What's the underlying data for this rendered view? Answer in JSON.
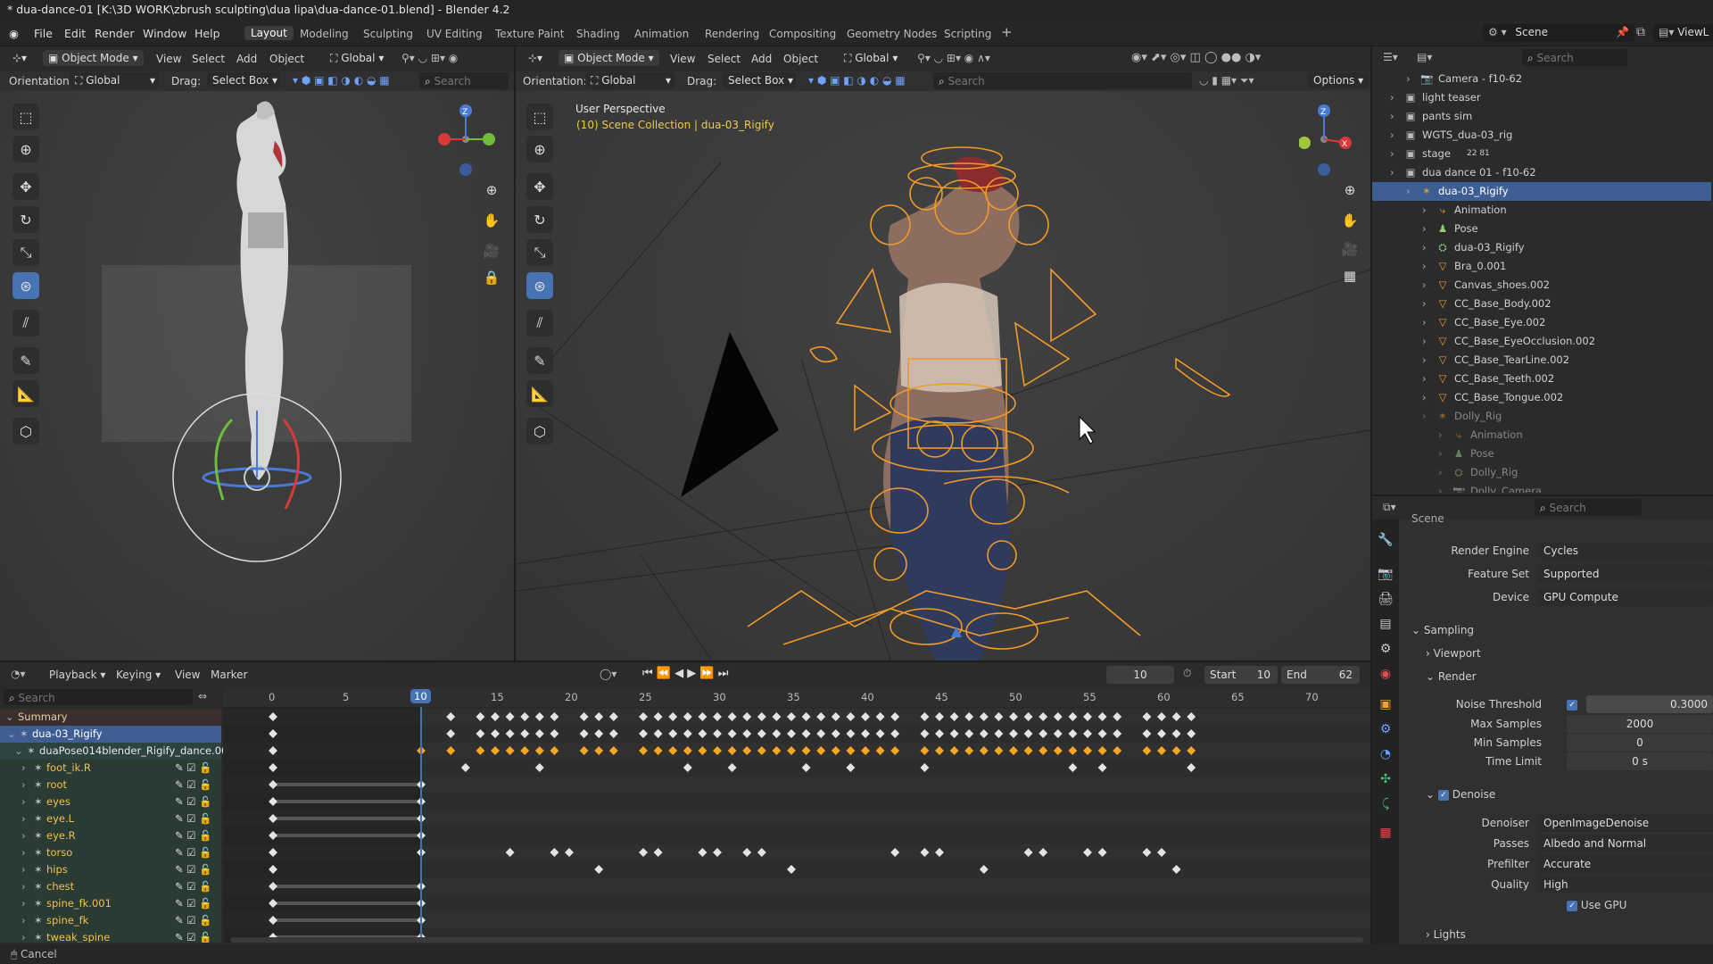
{
  "window": {
    "title": "* dua-dance-01 [K:\\3D WORK\\zbrush sculpting\\dua lipa\\dua-dance-01.blend] - Blender 4.2"
  },
  "menu": [
    "File",
    "Edit",
    "Render",
    "Window",
    "Help"
  ],
  "workspaces": [
    "Layout",
    "Modeling",
    "Sculpting",
    "UV Editing",
    "Texture Paint",
    "Shading",
    "Animation",
    "Rendering",
    "Compositing",
    "Geometry Nodes",
    "Scripting"
  ],
  "active_workspace": "Layout",
  "scene": {
    "name": "Scene",
    "view_layer": "ViewL"
  },
  "vp_left": {
    "mode": "Object Mode",
    "menus": [
      "View",
      "Select",
      "Add",
      "Object"
    ],
    "transform": "Global",
    "orientation_label": "Orientation:",
    "orientation": "Global",
    "drag_label": "Drag:",
    "drag": "Select Box",
    "search_placeholder": "Search"
  },
  "vp_main": {
    "mode": "Object Mode",
    "menus": [
      "View",
      "Select",
      "Add",
      "Object"
    ],
    "transform": "Global",
    "orientation_label": "Orientation:",
    "orientation": "Global",
    "drag_label": "Drag:",
    "drag": "Select Box",
    "search_placeholder": "Search",
    "options": "Options",
    "view_name": "User Perspective",
    "collection": "(10) Scene Collection | dua-03_Rigify",
    "gizmo": {
      "z": "Z",
      "x": "X"
    }
  },
  "outliner": {
    "search_placeholder": "Search",
    "rows": [
      {
        "label": "Camera - f10-62",
        "icon": "camera-icon",
        "depth": 2
      },
      {
        "label": "light teaser",
        "icon": "collection-icon",
        "depth": 1
      },
      {
        "label": "pants sim",
        "icon": "collection-icon",
        "depth": 1
      },
      {
        "label": "WGTS_dua-03_rig",
        "icon": "collection-icon",
        "depth": 1
      },
      {
        "label": "stage",
        "icon": "collection-icon",
        "depth": 1,
        "badge": "22  81"
      },
      {
        "label": "dua dance 01 - f10-62",
        "icon": "collection-icon",
        "depth": 1
      },
      {
        "label": "dua-03_Rigify",
        "icon": "armature-icon",
        "depth": 2,
        "selected": true
      },
      {
        "label": "Animation",
        "icon": "animation-icon",
        "depth": 3
      },
      {
        "label": "Pose",
        "icon": "pose-icon",
        "depth": 3
      },
      {
        "label": "dua-03_Rigify",
        "icon": "armature-data-icon",
        "depth": 3
      },
      {
        "label": "Bra_0.001",
        "icon": "mesh-icon",
        "depth": 3
      },
      {
        "label": "Canvas_shoes.002",
        "icon": "mesh-icon",
        "depth": 3
      },
      {
        "label": "CC_Base_Body.002",
        "icon": "mesh-icon",
        "depth": 3
      },
      {
        "label": "CC_Base_Eye.002",
        "icon": "mesh-icon",
        "depth": 3
      },
      {
        "label": "CC_Base_EyeOcclusion.002",
        "icon": "mesh-icon",
        "depth": 3
      },
      {
        "label": "CC_Base_TearLine.002",
        "icon": "mesh-icon",
        "depth": 3
      },
      {
        "label": "CC_Base_Teeth.002",
        "icon": "mesh-icon",
        "depth": 3
      },
      {
        "label": "CC_Base_Tongue.002",
        "icon": "mesh-icon",
        "depth": 3
      },
      {
        "label": "Dolly_Rig",
        "icon": "armature-icon",
        "depth": 3,
        "dim": true
      },
      {
        "label": "Animation",
        "icon": "animation-icon",
        "depth": 4,
        "dim": true
      },
      {
        "label": "Pose",
        "icon": "pose-icon",
        "depth": 4,
        "dim": true
      },
      {
        "label": "Dolly_Rig",
        "icon": "armature-data-icon",
        "depth": 4,
        "dim": true
      },
      {
        "label": "Dolly_Camera",
        "icon": "camera-icon",
        "depth": 4,
        "dim": true
      }
    ]
  },
  "properties": {
    "search_placeholder": "Search",
    "section": "Scene",
    "render_engine": {
      "label": "Render Engine",
      "value": "Cycles"
    },
    "feature_set": {
      "label": "Feature Set",
      "value": "Supported"
    },
    "device": {
      "label": "Device",
      "value": "GPU Compute"
    },
    "sampling": "Sampling",
    "viewport": "Viewport",
    "render": "Render",
    "noise_threshold": {
      "label": "Noise Threshold",
      "value": "0.3000",
      "checked": true
    },
    "max_samples": {
      "label": "Max Samples",
      "value": "2000"
    },
    "min_samples": {
      "label": "Min Samples",
      "value": "0"
    },
    "time_limit": {
      "label": "Time Limit",
      "value": "0 s"
    },
    "denoise": {
      "label": "Denoise",
      "checked": true
    },
    "denoiser": {
      "label": "Denoiser",
      "value": "OpenImageDenoise"
    },
    "passes": {
      "label": "Passes",
      "value": "Albedo and Normal"
    },
    "prefilter": {
      "label": "Prefilter",
      "value": "Accurate"
    },
    "quality": {
      "label": "Quality",
      "value": "High"
    },
    "use_gpu": {
      "label": "Use GPU",
      "checked": true
    },
    "lights": "Lights"
  },
  "timeline": {
    "menus": [
      "Playback",
      "Keying",
      "View",
      "Marker"
    ],
    "current_frame": "10",
    "start_label": "Start",
    "start": "10",
    "end_label": "End",
    "end": "62",
    "search_placeholder": "Search",
    "ruler": [
      "0",
      "5",
      "10",
      "15",
      "20",
      "25",
      "30",
      "35",
      "40",
      "45",
      "50",
      "55",
      "60",
      "65",
      "70"
    ],
    "playhead": "10",
    "channels": [
      {
        "label": "Summary",
        "kind": "summary"
      },
      {
        "label": "dua-03_Rigify",
        "kind": "object"
      },
      {
        "label": "duaPose014blender_Rigify_dance.001",
        "kind": "action"
      },
      {
        "label": "foot_ik.R",
        "kind": "bone"
      },
      {
        "label": "root",
        "kind": "bone"
      },
      {
        "label": "eyes",
        "kind": "bone"
      },
      {
        "label": "eye.L",
        "kind": "bone"
      },
      {
        "label": "eye.R",
        "kind": "bone"
      },
      {
        "label": "torso",
        "kind": "bone"
      },
      {
        "label": "hips",
        "kind": "bone"
      },
      {
        "label": "chest",
        "kind": "bone"
      },
      {
        "label": "spine_fk.001",
        "kind": "bone"
      },
      {
        "label": "spine_fk",
        "kind": "bone"
      },
      {
        "label": "tweak_spine",
        "kind": "bone"
      }
    ],
    "keys": [
      [
        0,
        12,
        14,
        15,
        16,
        17,
        18,
        19,
        21,
        22,
        23,
        25,
        26,
        27,
        28,
        29,
        30,
        31,
        32,
        33,
        34,
        35,
        36,
        37,
        38,
        39,
        40,
        41,
        42,
        44,
        45,
        46,
        47,
        48,
        49,
        50,
        51,
        52,
        53,
        54,
        55,
        56,
        57,
        59,
        60,
        61,
        62
      ],
      [
        0,
        12,
        14,
        15,
        16,
        17,
        18,
        19,
        21,
        22,
        23,
        25,
        26,
        27,
        28,
        29,
        30,
        31,
        32,
        33,
        34,
        35,
        36,
        37,
        38,
        39,
        40,
        41,
        42,
        44,
        45,
        46,
        47,
        48,
        49,
        50,
        51,
        52,
        53,
        54,
        55,
        56,
        57,
        59,
        60,
        61,
        62
      ],
      [
        0,
        10,
        12,
        14,
        15,
        16,
        17,
        18,
        19,
        21,
        22,
        23,
        25,
        26,
        27,
        28,
        29,
        30,
        31,
        32,
        33,
        34,
        35,
        36,
        37,
        38,
        39,
        40,
        41,
        42,
        44,
        45,
        46,
        47,
        48,
        49,
        50,
        51,
        52,
        53,
        54,
        55,
        56,
        57,
        59,
        60,
        61,
        62
      ],
      [
        0,
        13,
        18,
        28,
        31,
        36,
        39,
        44,
        54,
        56,
        62
      ],
      [
        0,
        10
      ],
      [
        0,
        10
      ],
      [
        0,
        10
      ],
      [
        0,
        10
      ],
      [
        0,
        10,
        16,
        19,
        20,
        25,
        26,
        29,
        30,
        32,
        33,
        42,
        44,
        45,
        51,
        52,
        55,
        56,
        59,
        60
      ],
      [
        0,
        22,
        35,
        48,
        61
      ],
      [
        0,
        10
      ],
      [
        0,
        10
      ],
      [
        0,
        10
      ],
      [
        0,
        10
      ]
    ]
  },
  "status": {
    "text": "Cancel"
  }
}
